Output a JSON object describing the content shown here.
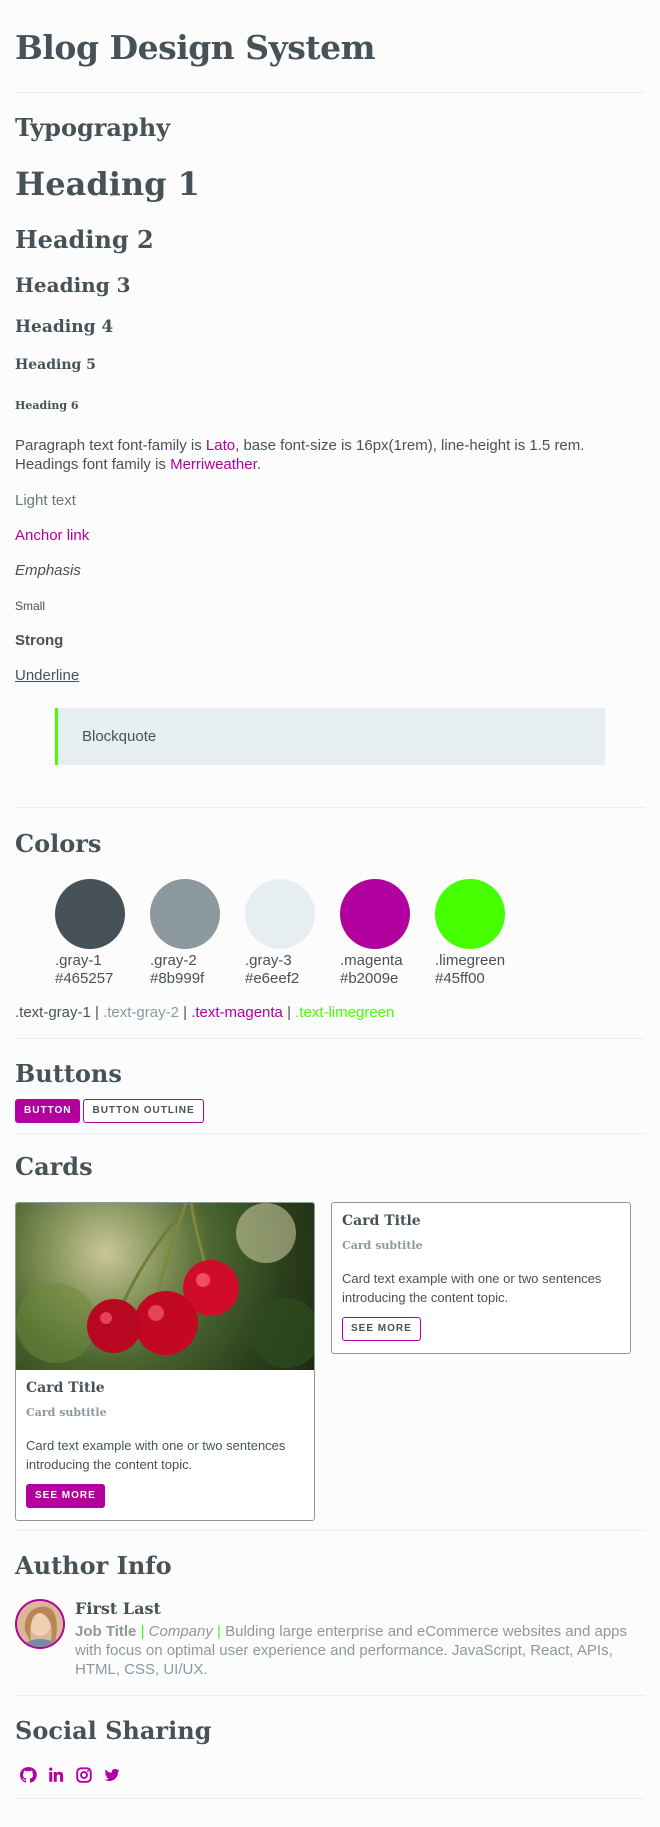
{
  "page_title": "Blog Design System",
  "typography": {
    "title": "Typography",
    "h1": "Heading 1",
    "h2": "Heading 2",
    "h3": "Heading 3",
    "h4": "Heading 4",
    "h5": "Heading 5",
    "h6": "Heading 6",
    "para_part1": "Paragraph text font-family is ",
    "para_lato": "Lato",
    "para_part2": ", base font-size is 16px(1rem), line-height is 1.5 rem. Headings font family is ",
    "para_merri": "Merriweather",
    "para_part3": ".",
    "light": "Light text",
    "anchor": "Anchor link",
    "emphasis": "Emphasis",
    "small": "Small",
    "strong": "Strong",
    "underline": "Underline",
    "blockquote": "Blockquote"
  },
  "colors": {
    "title": "Colors",
    "swatches": [
      {
        "name": ".gray-1",
        "hex": "#465257",
        "color": "#465257"
      },
      {
        "name": ".gray-2",
        "hex": "#8b999f",
        "color": "#8b999f"
      },
      {
        "name": ".gray-3",
        "hex": "#e6eef2",
        "color": "#e6eef2"
      },
      {
        "name": ".magenta",
        "hex": "#b2009e",
        "color": "#b2009e"
      },
      {
        "name": ".limegreen",
        "hex": "#45ff00",
        "color": "#45ff00"
      }
    ],
    "text_gray1": ".text-gray-1",
    "text_gray2": ".text-gray-2",
    "text_magenta": ".text-magenta",
    "text_lime": ".text-limegreen",
    "separator": " | "
  },
  "buttons": {
    "title": "Buttons",
    "button": "BUTTON",
    "outline": "BUTTON OUTLINE"
  },
  "cards": {
    "title": "Cards",
    "items": [
      {
        "title": "Card Title",
        "subtitle": "Card subtitle",
        "text": "Card text example with one or two sentences introducing the content topic.",
        "cta": "SEE MORE",
        "image": "cherries-image"
      },
      {
        "title": "Card Title",
        "subtitle": "Card subtitle",
        "text": "Card text example with one or two sentences introducing the content topic.",
        "cta": "SEE MORE"
      }
    ]
  },
  "author": {
    "title": "Author Info",
    "name": "First Last",
    "job_title": "Job Title",
    "company": "Company",
    "bio": " Bulding large enterprise and eCommerce websites and apps with focus on optimal user experience and performance. JavaScript, React, APIs, HTML, CSS, UI/UX.",
    "sep": "|"
  },
  "social": {
    "title": "Social Sharing",
    "icons": [
      "github-icon",
      "linkedin-icon",
      "instagram-icon",
      "twitter-icon"
    ]
  }
}
